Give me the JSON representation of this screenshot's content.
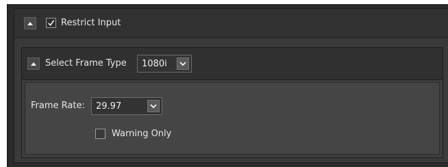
{
  "restrict": {
    "label": "Restrict Input",
    "checked": true
  },
  "frame_type": {
    "label": "Select Frame Type",
    "value": "1080i"
  },
  "frame_rate": {
    "label": "Frame Rate:",
    "value": "29.97"
  },
  "warning": {
    "label": "Warning Only",
    "checked": false
  }
}
